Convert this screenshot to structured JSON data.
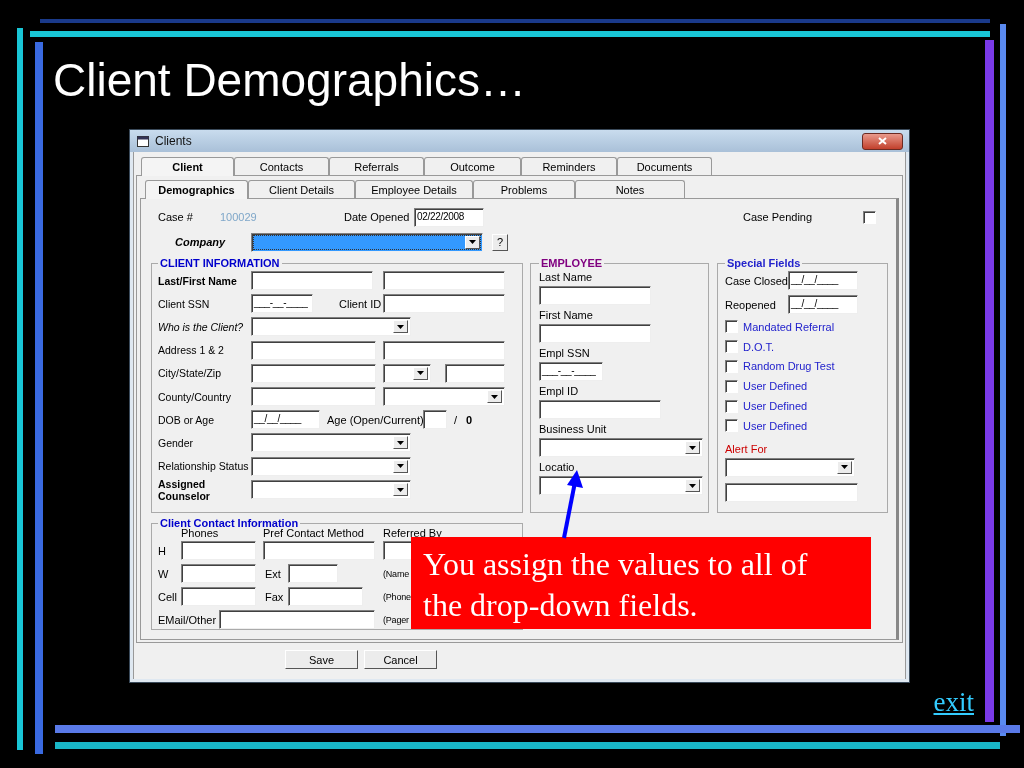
{
  "slide": {
    "title": "Client Demographics…",
    "exit_link": "exit"
  },
  "window": {
    "title": "Clients"
  },
  "tabs": [
    {
      "label": "Client",
      "selected": true
    },
    {
      "label": "Contacts",
      "selected": false
    },
    {
      "label": "Referrals",
      "selected": false
    },
    {
      "label": "Outcome",
      "selected": false
    },
    {
      "label": "Reminders",
      "selected": false
    },
    {
      "label": "Documents",
      "selected": false
    }
  ],
  "subtabs": [
    {
      "label": "Demographics",
      "selected": true
    },
    {
      "label": "Client Details",
      "selected": false
    },
    {
      "label": "Employee Details",
      "selected": false
    },
    {
      "label": "Problems",
      "selected": false
    },
    {
      "label": "Notes",
      "selected": false
    }
  ],
  "case": {
    "label": "Case #",
    "number": "100029",
    "date_label": "Date Opened",
    "date_opened": "02/22/2008",
    "pending_label": "Case Pending",
    "pending": false
  },
  "company": {
    "label": "Company",
    "highlighted": true,
    "help_button": "?"
  },
  "client_information": {
    "legend": "CLIENT INFORMATION",
    "rows": [
      {
        "label": "Last/First Name",
        "controls": [
          {
            "kind": "field"
          },
          {
            "kind": "field"
          }
        ]
      },
      {
        "label": "Client SSN",
        "controls": [
          {
            "kind": "field",
            "value": "___-__-____"
          },
          {
            "kind": "label",
            "text": "Client ID"
          },
          {
            "kind": "field"
          }
        ]
      },
      {
        "label": "Who is the Client?",
        "controls": [
          {
            "kind": "dropdown"
          }
        ]
      },
      {
        "label": "Address 1 & 2",
        "controls": [
          {
            "kind": "field"
          },
          {
            "kind": "field"
          }
        ]
      },
      {
        "label": "City/State/Zip",
        "controls": [
          {
            "kind": "field"
          },
          {
            "kind": "dropdown"
          },
          {
            "kind": "field"
          }
        ]
      },
      {
        "label": "County/Country",
        "controls": [
          {
            "kind": "field"
          },
          {
            "kind": "dropdown"
          }
        ]
      },
      {
        "label": "DOB or Age",
        "controls": [
          {
            "kind": "field",
            "value": "__/__/____"
          },
          {
            "kind": "label",
            "text": "Age (Open/Current)"
          },
          {
            "kind": "field"
          },
          {
            "kind": "label",
            "text": "/"
          },
          {
            "kind": "strong",
            "text": "0"
          }
        ]
      },
      {
        "label": "Gender",
        "controls": [
          {
            "kind": "dropdown"
          }
        ]
      },
      {
        "label": "Relationship Status",
        "controls": [
          {
            "kind": "dropdown"
          }
        ]
      },
      {
        "label": "Assigned Counselor",
        "controls": [
          {
            "kind": "dropdown"
          }
        ]
      }
    ]
  },
  "client_contact": {
    "legend": "Client Contact Information",
    "columns": [
      "Phones",
      "Pref Contact Method",
      "Referred By"
    ],
    "rows": [
      {
        "items": [
          {
            "kind": "label",
            "text": "H"
          },
          {
            "kind": "field"
          },
          {
            "kind": "field"
          },
          {
            "kind": "field"
          }
        ]
      },
      {
        "items": [
          {
            "kind": "label",
            "text": "W"
          },
          {
            "kind": "field"
          },
          {
            "kind": "label",
            "text": "Ext"
          },
          {
            "kind": "field"
          },
          {
            "kind": "label",
            "text": "(Name"
          }
        ]
      },
      {
        "items": [
          {
            "kind": "label",
            "text": "Cell"
          },
          {
            "kind": "field"
          },
          {
            "kind": "label",
            "text": "Fax"
          },
          {
            "kind": "field"
          },
          {
            "kind": "label",
            "text": "(Phone"
          }
        ]
      },
      {
        "items": [
          {
            "kind": "label",
            "text": "EMail/Other"
          },
          {
            "kind": "field"
          },
          {
            "kind": "label",
            "text": "(Pager"
          }
        ]
      }
    ]
  },
  "employee": {
    "legend": "EMPLOYEE",
    "fields": [
      {
        "label": "Last Name",
        "kind": "field"
      },
      {
        "label": "First Name",
        "kind": "field"
      },
      {
        "label": "Empl SSN",
        "kind": "field",
        "value": "___-__-____"
      },
      {
        "label": "Empl ID",
        "kind": "field"
      },
      {
        "label": "Business Unit",
        "kind": "dropdown"
      },
      {
        "label": "Locatio",
        "kind": "dropdown"
      }
    ]
  },
  "special_fields": {
    "legend": "Special Fields",
    "dates": [
      {
        "label": "Case Closed",
        "value": "__/__/____"
      },
      {
        "label": "Reopened",
        "value": "__/__/____"
      }
    ],
    "checkboxes": [
      {
        "label": "Mandated Referral",
        "checked": false
      },
      {
        "label": "D.O.T.",
        "checked": false
      },
      {
        "label": "Random Drug Test",
        "checked": false
      },
      {
        "label": "User Defined",
        "checked": false
      },
      {
        "label": "User Defined",
        "checked": false
      },
      {
        "label": "User Defined",
        "checked": false
      }
    ],
    "alert_label": "Alert For"
  },
  "buttons": [
    "Save",
    "Cancel"
  ],
  "callout": {
    "text": "You assign the values to all of the drop-down fields."
  }
}
